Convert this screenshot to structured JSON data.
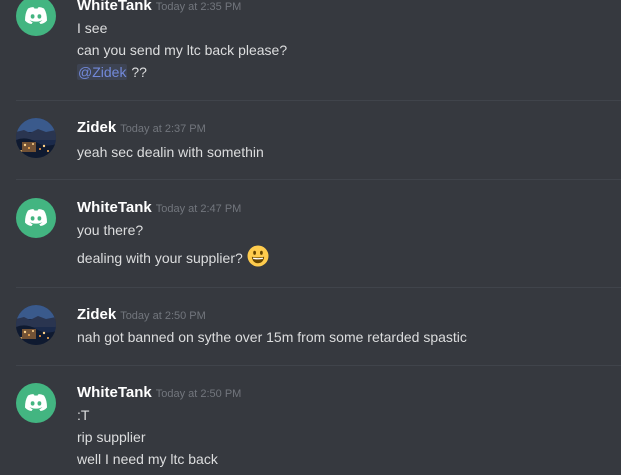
{
  "messages": [
    {
      "author": "WhiteTank",
      "timestamp": "Today at 2:35 PM",
      "avatar": "discord-logo-avatar",
      "lines": [
        "I see",
        "can you send my ltc back please?"
      ],
      "mention": "@Zidek",
      "mention_suffix": " ??"
    },
    {
      "author": "Zidek",
      "timestamp": "Today at 2:37 PM",
      "avatar": "city-photo-avatar",
      "lines": [
        "yeah sec dealin with somethin"
      ]
    },
    {
      "author": "WhiteTank",
      "timestamp": "Today at 2:47 PM",
      "avatar": "discord-logo-avatar",
      "lines": [
        "you there?",
        "dealing with your supplier?"
      ],
      "emoji": "smiley-emoji"
    },
    {
      "author": "Zidek",
      "timestamp": "Today at 2:50 PM",
      "avatar": "city-photo-avatar",
      "lines": [
        "nah got banned on sythe over 15m from some retarded spastic"
      ]
    },
    {
      "author": "WhiteTank",
      "timestamp": "Today at 2:50 PM",
      "avatar": "discord-logo-avatar",
      "lines": [
        ":T",
        "rip supplier",
        "well I need my ltc back"
      ]
    }
  ],
  "colors": {
    "background": "#36393f",
    "username": "#ffffff",
    "timestamp": "#72767d",
    "message_text": "#dcddde",
    "mention": "#7289da",
    "discord_avatar": "#43b581",
    "divider": "#40444b"
  }
}
